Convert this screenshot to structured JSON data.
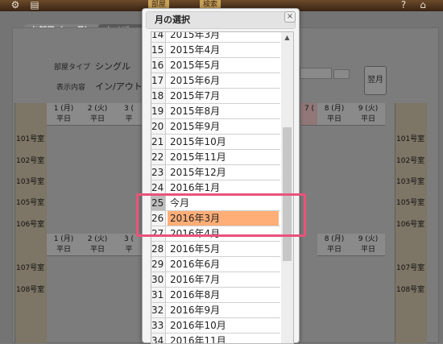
{
  "topbar": {
    "icons": [
      "gear-icon",
      "printer-icon",
      "help-icon",
      "home-icon"
    ],
    "btn1": "部屋",
    "btn2": "検索"
  },
  "tabs": [
    {
      "label": "お部屋（1ヶ月）"
    },
    {
      "label": "タイプ（1"
    }
  ],
  "filters": {
    "room_type_label": "部屋タイプ",
    "room_type_value": "シングル",
    "display_label": "表示内容",
    "display_value": "イン/アウト",
    "next_button": "翌月"
  },
  "calendar": {
    "columns_left": [
      {
        "day": "1 (月)",
        "sub": "平日"
      },
      {
        "day": "2 (火)",
        "sub": "平日"
      },
      {
        "day": "3 (",
        "sub": "平"
      }
    ],
    "columns_right": [
      {
        "day": "7 (",
        "sub": ""
      },
      {
        "day": "8 (月)",
        "sub": "平日"
      },
      {
        "day": "9 (火)",
        "sub": "平日"
      }
    ],
    "rooms_top": [
      "101号室",
      "102号室",
      "103号室",
      "105号室",
      "106号室"
    ],
    "rooms_bottom": [
      "107号室",
      "108号室"
    ]
  },
  "modal": {
    "title": "月の選択",
    "close": "×",
    "items": [
      {
        "num": "14",
        "label": "2015年3月"
      },
      {
        "num": "15",
        "label": "2015年4月"
      },
      {
        "num": "16",
        "label": "2015年5月"
      },
      {
        "num": "17",
        "label": "2015年6月"
      },
      {
        "num": "18",
        "label": "2015年7月"
      },
      {
        "num": "19",
        "label": "2015年8月"
      },
      {
        "num": "20",
        "label": "2015年9月"
      },
      {
        "num": "21",
        "label": "2015年10月"
      },
      {
        "num": "22",
        "label": "2015年11月"
      },
      {
        "num": "23",
        "label": "2015年12月"
      },
      {
        "num": "24",
        "label": "2016年1月"
      },
      {
        "num": "25",
        "label": "今月"
      },
      {
        "num": "26",
        "label": "2016年3月"
      },
      {
        "num": "27",
        "label": "2016年4月"
      },
      {
        "num": "28",
        "label": "2016年5月"
      },
      {
        "num": "29",
        "label": "2016年6月"
      },
      {
        "num": "30",
        "label": "2016年7月"
      },
      {
        "num": "31",
        "label": "2016年8月"
      },
      {
        "num": "32",
        "label": "2016年9月"
      },
      {
        "num": "33",
        "label": "2016年10月"
      },
      {
        "num": "34",
        "label": "2016年11月"
      }
    ],
    "selected_index": 12,
    "today_index": 11
  },
  "colors": {
    "selected": "#ffae78",
    "highlight": "#e8537a"
  }
}
